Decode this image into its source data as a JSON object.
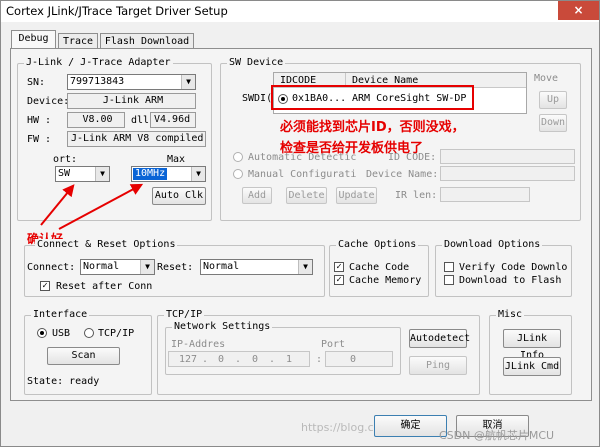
{
  "window": {
    "title": "Cortex JLink/JTrace Target Driver Setup",
    "close": "×"
  },
  "tabs": [
    "Debug",
    "Trace",
    "Flash Download"
  ],
  "adapter": {
    "legend": "J-Link / J-Trace Adapter",
    "sn_label": "SN:",
    "sn_value": "799713843",
    "device_label": "Device:",
    "device_value": "J-Link ARM",
    "hw_label": "HW :",
    "hw_value": "V8.00",
    "dll_label": "dll",
    "dll_value": "V4.96d",
    "fw_label": "FW :",
    "fw_value": "J-Link ARM V8 compiled I",
    "port_label": "ort:",
    "port_value": "SW",
    "max_label": "Max",
    "max_value": "10MHz",
    "auto_clk": "Auto Clk"
  },
  "sw_device": {
    "legend": "SW Device",
    "col_idcode": "IDCODE",
    "col_name": "Device Name",
    "row_label": "SWDI(",
    "row_idcode": "0x1BA0...",
    "row_name": "ARM CoreSight SW-DP",
    "move_label": "Move",
    "up": "Up",
    "down": "Down",
    "auto_detect": "Automatic Detectic",
    "manual": "Manual Configurati",
    "id_code_label": "ID CODE:",
    "device_name_label": "Device Name:",
    "ir_len_label": "IR len:",
    "add": "Add",
    "delete": "Delete",
    "update": "Update"
  },
  "annotations": {
    "line1": "必须能找到芯片ID，否则没戏，",
    "line2": "检查是否给开发板供电了",
    "confirm": "确认好",
    "color": "#e60000"
  },
  "connect": {
    "legend": "Connect & Reset Options",
    "connect_label": "Connect:",
    "connect_value": "Normal",
    "reset_label": "Reset:",
    "reset_value": "Normal",
    "reset_after": "Reset after Conn"
  },
  "cache": {
    "legend": "Cache Options",
    "code": "Cache Code",
    "memory": "Cache Memory"
  },
  "download": {
    "legend": "Download Options",
    "verify": "Verify Code Downlo",
    "to_flash": "Download to Flash"
  },
  "interface": {
    "legend": "Interface",
    "usb": "USB",
    "tcpip": "TCP/IP",
    "scan": "Scan",
    "state": "State: ready"
  },
  "tcpip": {
    "legend": "TCP/IP",
    "network_legend": "Network Settings",
    "ip_label": "IP-Addres",
    "port_label": "Port",
    "ip": [
      "127",
      "0",
      "0",
      "1"
    ],
    "dot": ".",
    "colon": ":",
    "port_value": "0",
    "autodetect": "Autodetect",
    "ping": "Ping"
  },
  "misc": {
    "legend": "Misc",
    "jlink_info": "JLink Info",
    "jlink_cmd": "JLink Cmd"
  },
  "footer": {
    "ok": "确定",
    "cancel": "取消",
    "watermark_left": "https://blog.c",
    "watermark_right": "CSDN @航帆芯片MCU"
  }
}
